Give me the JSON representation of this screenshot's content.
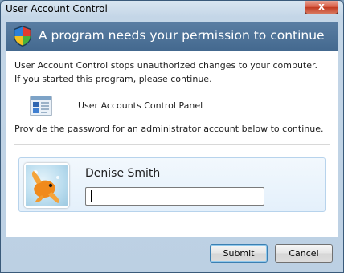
{
  "window": {
    "title": "User Account Control",
    "close_glyph": "x"
  },
  "banner": {
    "heading": "A program needs your permission to continue",
    "icon": "shield-icon"
  },
  "content": {
    "description_line1": "User Account Control stops unauthorized changes to your computer.",
    "description_line2": "If you started this program, please continue.",
    "program_name": "User Accounts Control Panel",
    "program_icon": "control-panel-icon",
    "prompt": "Provide the password for an administrator account below to continue."
  },
  "user": {
    "name": "Denise Smith",
    "avatar": "goldfish-avatar",
    "password_value": ""
  },
  "buttons": {
    "submit": "Submit",
    "cancel": "Cancel"
  },
  "colors": {
    "banner": "#44698f",
    "tile_border": "#b7d3ec",
    "close": "#c13b22"
  }
}
